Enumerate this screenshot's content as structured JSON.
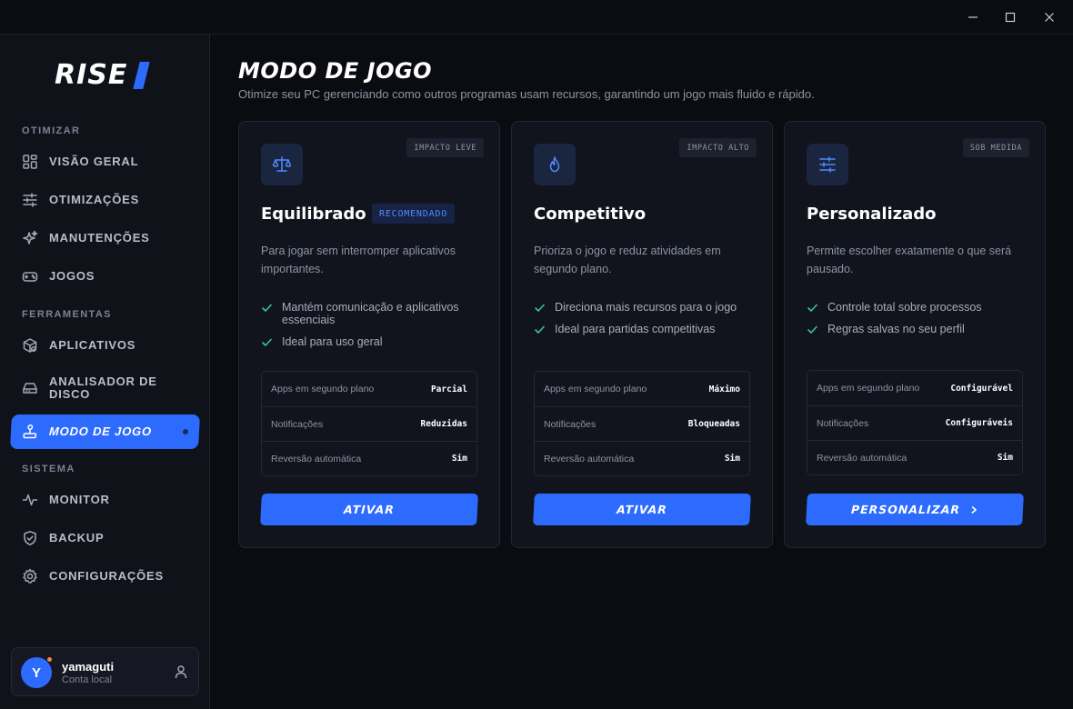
{
  "window": {
    "controls": [
      "minimize",
      "maximize",
      "close"
    ]
  },
  "sidebar": {
    "logo": "RISE",
    "sections": [
      {
        "label": "OTIMIZAR",
        "items": [
          {
            "label": "VISÃO GERAL",
            "icon": "grid-icon"
          },
          {
            "label": "OTIMIZAÇÕES",
            "icon": "sliders-icon"
          },
          {
            "label": "MANUTENÇÕES",
            "icon": "sparkle-icon"
          },
          {
            "label": "JOGOS",
            "icon": "gamepad-icon"
          }
        ]
      },
      {
        "label": "FERRAMENTAS",
        "items": [
          {
            "label": "APLICATIVOS",
            "icon": "package-icon"
          },
          {
            "label": "ANALISADOR DE DISCO",
            "icon": "disk-icon"
          },
          {
            "label": "MODO DE JOGO",
            "icon": "joystick-icon",
            "active": true
          }
        ]
      },
      {
        "label": "SISTEMA",
        "items": [
          {
            "label": "MONITOR",
            "icon": "pulse-icon"
          },
          {
            "label": "BACKUP",
            "icon": "shield-icon"
          },
          {
            "label": "CONFIGURAÇÕES",
            "icon": "gear-icon"
          }
        ]
      }
    ],
    "user": {
      "initial": "Y",
      "name": "yamaguti",
      "subtitle": "Conta local"
    }
  },
  "main": {
    "title": "MODO DE JOGO",
    "subtitle": "Otimize seu PC gerenciando como outros programas usam recursos, garantindo um jogo mais fluido e rápido.",
    "cards": [
      {
        "badge": "IMPACTO LEVE",
        "icon": "balance-scale-icon",
        "title": "Equilibrado",
        "recommended": "RECOMENDADO",
        "description": "Para jogar sem interromper aplicativos importantes.",
        "features": [
          "Mantém comunicação e aplicativos essenciais",
          "Ideal para uso geral"
        ],
        "stats": [
          {
            "label": "Apps em segundo plano",
            "value": "Parcial"
          },
          {
            "label": "Notificações",
            "value": "Reduzidas"
          },
          {
            "label": "Reversão automática",
            "value": "Sim"
          }
        ],
        "button": "ATIVAR"
      },
      {
        "badge": "IMPACTO ALTO",
        "icon": "flame-icon",
        "title": "Competitivo",
        "description": "Prioriza o jogo e reduz atividades em segundo plano.",
        "features": [
          "Direciona mais recursos para o jogo",
          "Ideal para partidas competitivas"
        ],
        "stats": [
          {
            "label": "Apps em segundo plano",
            "value": "Máximo"
          },
          {
            "label": "Notificações",
            "value": "Bloqueadas"
          },
          {
            "label": "Reversão automática",
            "value": "Sim"
          }
        ],
        "button": "ATIVAR"
      },
      {
        "badge": "SOB MEDIDA",
        "icon": "sliders-icon",
        "title": "Personalizado",
        "description": "Permite escolher exatamente o que será pausado.",
        "features": [
          "Controle total sobre processos",
          "Regras salvas no seu perfil"
        ],
        "stats": [
          {
            "label": "Apps em segundo plano",
            "value": "Configurável"
          },
          {
            "label": "Notificações",
            "value": "Configuráveis"
          },
          {
            "label": "Reversão automática",
            "value": "Sim"
          }
        ],
        "button": "PERSONALIZAR"
      }
    ]
  },
  "colors": {
    "accent": "#2d6bff",
    "background": "#0b0c11",
    "card": "#11141d",
    "check": "#3bc48a",
    "presence": "#f58a2c"
  }
}
